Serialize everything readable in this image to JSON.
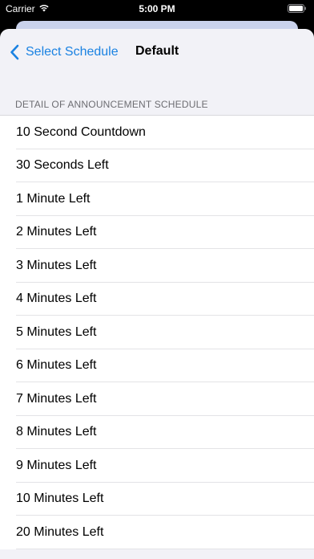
{
  "status_bar": {
    "carrier": "Carrier",
    "time": "5:00 PM"
  },
  "nav": {
    "back_label": "Select Schedule",
    "title": "Default"
  },
  "section": {
    "header": "DETAIL OF ANNOUNCEMENT SCHEDULE"
  },
  "items": [
    {
      "label": "10 Second Countdown"
    },
    {
      "label": "30 Seconds Left"
    },
    {
      "label": "1 Minute Left"
    },
    {
      "label": "2 Minutes Left"
    },
    {
      "label": "3 Minutes Left"
    },
    {
      "label": "4 Minutes Left"
    },
    {
      "label": "5 Minutes Left"
    },
    {
      "label": "6 Minutes Left"
    },
    {
      "label": "7 Minutes Left"
    },
    {
      "label": "8 Minutes Left"
    },
    {
      "label": "9 Minutes Left"
    },
    {
      "label": "10 Minutes Left"
    },
    {
      "label": "20 Minutes Left"
    }
  ],
  "colors": {
    "accent": "#1a82e2",
    "background": "#f2f2f7"
  }
}
